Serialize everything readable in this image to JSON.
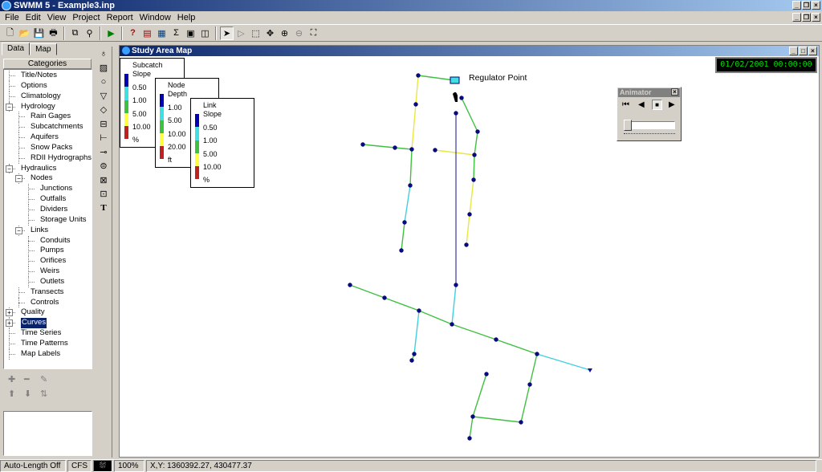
{
  "app": {
    "title": "SWMM 5 - Example3.inp"
  },
  "menu": [
    "File",
    "Edit",
    "View",
    "Project",
    "Report",
    "Window",
    "Help"
  ],
  "left_panel": {
    "tabs": [
      "Data",
      "Map"
    ],
    "header": "Categories",
    "tree": [
      {
        "label": "Title/Notes",
        "level": 0
      },
      {
        "label": "Options",
        "level": 0
      },
      {
        "label": "Climatology",
        "level": 0
      },
      {
        "label": "Hydrology",
        "level": 0,
        "expander": "minus"
      },
      {
        "label": "Rain Gages",
        "level": 1
      },
      {
        "label": "Subcatchments",
        "level": 1
      },
      {
        "label": "Aquifers",
        "level": 1
      },
      {
        "label": "Snow Packs",
        "level": 1
      },
      {
        "label": "RDII Hydrographs",
        "level": 1
      },
      {
        "label": "Hydraulics",
        "level": 0,
        "expander": "minus"
      },
      {
        "label": "Nodes",
        "level": 1,
        "expander": "minus"
      },
      {
        "label": "Junctions",
        "level": 2
      },
      {
        "label": "Outfalls",
        "level": 2
      },
      {
        "label": "Dividers",
        "level": 2
      },
      {
        "label": "Storage Units",
        "level": 2
      },
      {
        "label": "Links",
        "level": 1,
        "expander": "minus"
      },
      {
        "label": "Conduits",
        "level": 2
      },
      {
        "label": "Pumps",
        "level": 2
      },
      {
        "label": "Orifices",
        "level": 2
      },
      {
        "label": "Weirs",
        "level": 2
      },
      {
        "label": "Outlets",
        "level": 2
      },
      {
        "label": "Transects",
        "level": 1
      },
      {
        "label": "Controls",
        "level": 1
      },
      {
        "label": "Quality",
        "level": 0,
        "expander": "plus"
      },
      {
        "label": "Curves",
        "level": 0,
        "expander": "plus",
        "selected": true
      },
      {
        "label": "Time Series",
        "level": 0
      },
      {
        "label": "Time Patterns",
        "level": 0
      },
      {
        "label": "Map Labels",
        "level": 0
      }
    ]
  },
  "map_window": {
    "title": "Study Area Map",
    "clock": "01/02/2001 00:00:00",
    "label": "Regulator Point",
    "legends": [
      {
        "title1": "Subcatch",
        "title2": "Slope",
        "values": [
          "0.50",
          "1.00",
          "5.00",
          "10.00"
        ],
        "unit": "%"
      },
      {
        "title1": "Node",
        "title2": "Depth",
        "values": [
          "1.00",
          "5.00",
          "10.00",
          "20.00"
        ],
        "unit": "ft"
      },
      {
        "title1": "Link",
        "title2": "Slope",
        "values": [
          "0.50",
          "1.00",
          "5.00",
          "10.00"
        ],
        "unit": "%"
      }
    ],
    "legend_colors": [
      "#0000b0",
      "#40e0e0",
      "#40c040",
      "#ffff40",
      "#c02020"
    ],
    "animator": {
      "title": "Animator"
    }
  },
  "status": {
    "auto_length": "Auto-Length Off",
    "flow_units": "CFS",
    "zoom": "100%",
    "coords": "X,Y: 1360392.27, 430477.37"
  },
  "colors": {
    "title_bar": "#0a246a",
    "clock_text": "#00e000",
    "node": "#0a0a80"
  }
}
